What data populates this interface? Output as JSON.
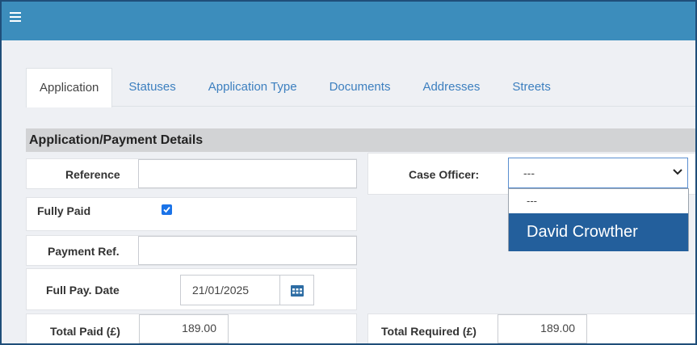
{
  "tabs": [
    {
      "label": "Application"
    },
    {
      "label": "Statuses"
    },
    {
      "label": "Application Type"
    },
    {
      "label": "Documents"
    },
    {
      "label": "Addresses"
    },
    {
      "label": "Streets"
    }
  ],
  "section": {
    "title": "Application/Payment Details"
  },
  "fields": {
    "reference": {
      "label": "Reference",
      "value": ""
    },
    "fully_paid": {
      "label": "Fully Paid",
      "checked": true
    },
    "payment_ref": {
      "label": "Payment Ref.",
      "value": ""
    },
    "full_pay_date": {
      "label": "Full Pay. Date",
      "value": "21/01/2025"
    },
    "total_paid": {
      "label": "Total Paid (£)",
      "value": "189.00"
    },
    "case_officer": {
      "label": "Case Officer:",
      "value": "---"
    },
    "total_required": {
      "label": "Total Required (£)",
      "value": "189.00"
    }
  },
  "case_officer_options": {
    "blank": "---",
    "highlighted": "David Crowther"
  },
  "icons": {
    "menu": "hamburger-menu-icon",
    "calendar": "calendar-icon",
    "chevron": "chevron-down-icon",
    "checkbox": "checkmark-icon"
  },
  "colors": {
    "header": "#3c8dbc",
    "link": "#3c7fbf",
    "highlight": "#235f9c"
  }
}
